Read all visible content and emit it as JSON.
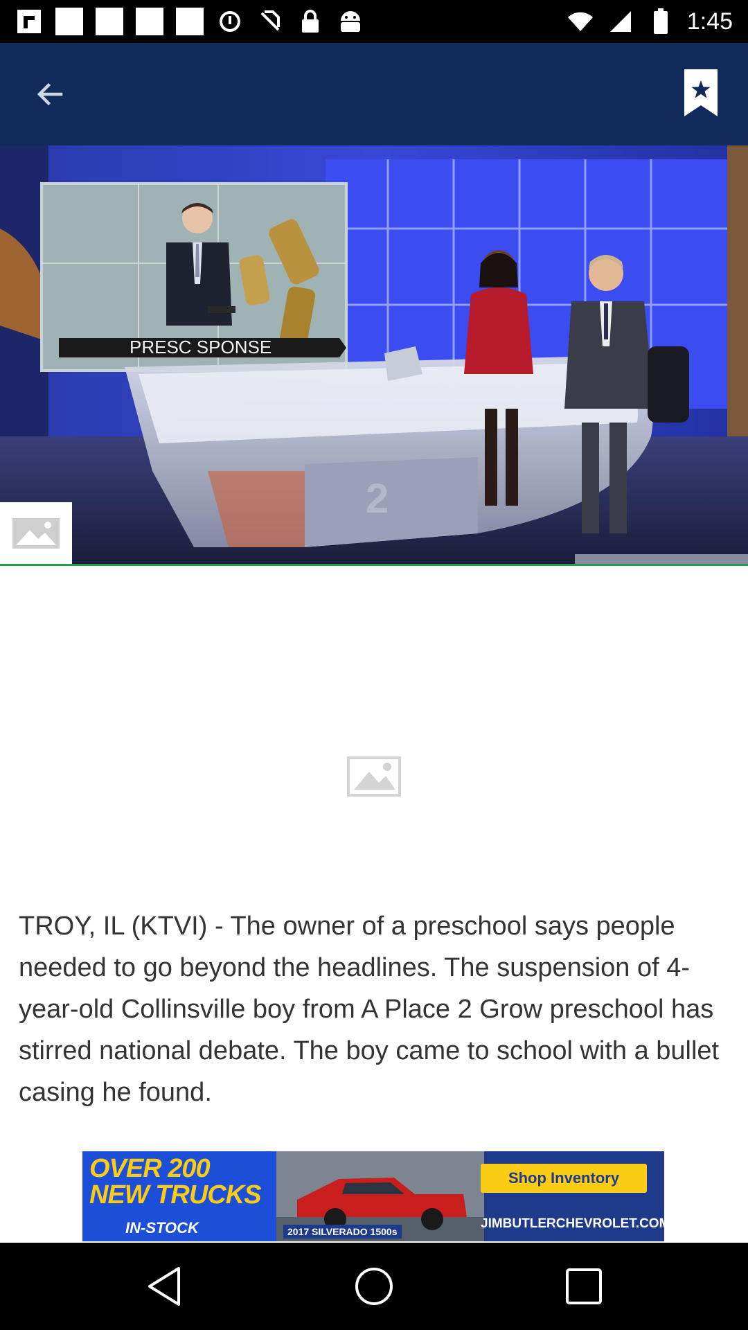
{
  "status_bar": {
    "time": "1:45",
    "icons": [
      "flipboard-icon",
      "notification-square-icon",
      "notification-square-icon",
      "notification-square-icon",
      "notification-square-icon",
      "data-saver-icon",
      "no-sim-icon",
      "lock-icon",
      "android-icon",
      "wifi-icon",
      "signal-icon",
      "battery-icon"
    ]
  },
  "app_bar": {
    "back_icon": "arrow-left-icon",
    "bookmark_icon": "bookmark-star-icon"
  },
  "hero": {
    "lower_third_text": "PRESC SPONSE",
    "gallery_icon": "image-icon"
  },
  "placeholder": {
    "icon": "image-placeholder-icon"
  },
  "article": {
    "body": "TROY, IL (KTVI) - The owner of a preschool says people needed to go beyond the headlines. The suspension of 4-year-old Collinsville boy from A Place 2 Grow preschool has stirred national debate. The boy came to school with a bullet casing he found."
  },
  "ad": {
    "headline_line1": "OVER 200",
    "headline_line2": "NEW TRUCKS",
    "instock": "IN-STOCK",
    "model": "2017 SILVERADO 1500s",
    "cta": "Shop Inventory",
    "url": "JIMBUTLERCHEVROLET.COM"
  },
  "nav_bar": {
    "back_icon": "nav-back-icon",
    "home_icon": "nav-home-icon",
    "recents_icon": "nav-recents-icon"
  },
  "colors": {
    "app_bar": "#112a5a",
    "hero_divider": "#21a04b",
    "ad_accent": "#facc15"
  }
}
